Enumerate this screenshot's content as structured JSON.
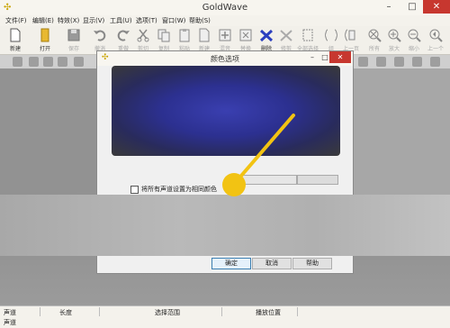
{
  "window": {
    "title": "GoldWave",
    "min": "–",
    "max": "□",
    "close": "✕"
  },
  "menu": [
    "文件(F)",
    "编辑(E)",
    "特效(X)",
    "显示(V)",
    "工具(U)",
    "选项(T)",
    "窗口(W)",
    "帮助(S)"
  ],
  "toolbar": [
    {
      "label": "新建",
      "icon": "new-file-icon",
      "enabled": true
    },
    {
      "label": "打开",
      "icon": "open-icon",
      "enabled": true
    },
    {
      "label": "保存",
      "icon": "save-icon",
      "enabled": false
    },
    {
      "label": "撤消",
      "icon": "undo-icon",
      "enabled": false
    },
    {
      "label": "重做",
      "icon": "redo-icon",
      "enabled": false
    },
    {
      "label": "剪切",
      "icon": "cut-icon",
      "enabled": false
    },
    {
      "label": "复制",
      "icon": "copy-icon",
      "enabled": false
    },
    {
      "label": "粘贴",
      "icon": "paste-icon",
      "enabled": false
    },
    {
      "label": "新建",
      "icon": "paste-new-icon",
      "enabled": false
    },
    {
      "label": "混音",
      "icon": "mix-icon",
      "enabled": false
    },
    {
      "label": "替换",
      "icon": "replace-icon",
      "enabled": false
    },
    {
      "label": "删除",
      "icon": "delete-icon",
      "enabled": true
    },
    {
      "label": "修剪",
      "icon": "trim-icon",
      "enabled": false
    },
    {
      "label": "全部选择",
      "icon": "select-all-icon",
      "enabled": false
    },
    {
      "label": "组",
      "icon": "group-icon",
      "enabled": false
    },
    {
      "label": "上一页",
      "icon": "prev-page-icon",
      "enabled": false
    },
    {
      "label": "所有",
      "icon": "zoom-all-icon",
      "enabled": false
    },
    {
      "label": "放大",
      "icon": "zoom-in-icon",
      "enabled": false
    },
    {
      "label": "缩小",
      "icon": "zoom-out-icon",
      "enabled": false
    },
    {
      "label": "上一个",
      "icon": "zoom-prev-icon",
      "enabled": false
    }
  ],
  "dialog": {
    "title": "颜色选项",
    "checkbox_label": "将所有声道设置为相同颜色",
    "ok": "确定",
    "cancel": "取消",
    "help": "帮助"
  },
  "status": {
    "headers": [
      "声道",
      "长度",
      "选择范围",
      "播放位置"
    ],
    "value": "声道"
  },
  "colors": {
    "accent_pointer": "#f2c313",
    "close_red": "#c7372f"
  }
}
